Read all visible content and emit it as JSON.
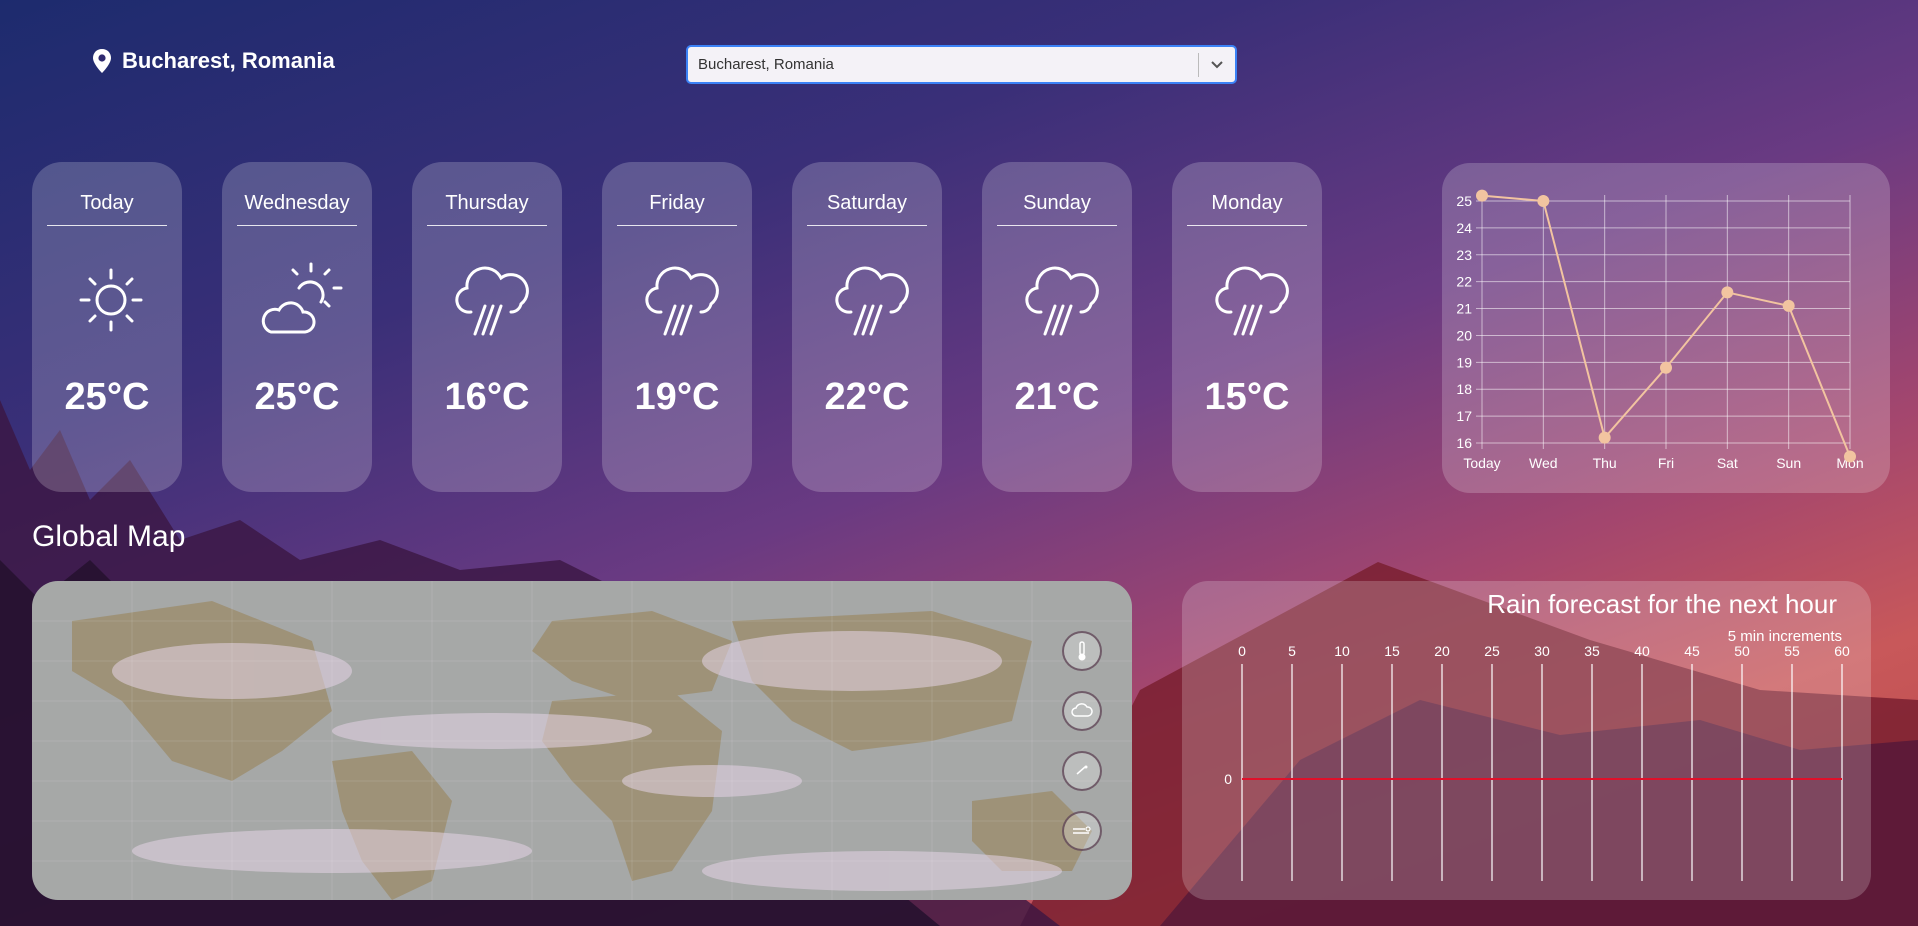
{
  "header": {
    "location_label": "Bucharest, Romania",
    "search": {
      "value": "Bucharest, Romania",
      "placeholder": "Bucharest, Romania"
    }
  },
  "forecast": [
    {
      "day": "Today",
      "icon": "sun-icon",
      "temp": "25°C"
    },
    {
      "day": "Wednesday",
      "icon": "sun-cloud-icon",
      "temp": "25°C"
    },
    {
      "day": "Thursday",
      "icon": "rain-cloud-icon",
      "temp": "16°C"
    },
    {
      "day": "Friday",
      "icon": "rain-cloud-icon",
      "temp": "19°C"
    },
    {
      "day": "Saturday",
      "icon": "rain-cloud-icon",
      "temp": "22°C"
    },
    {
      "day": "Sunday",
      "icon": "rain-cloud-icon",
      "temp": "21°C"
    },
    {
      "day": "Monday",
      "icon": "rain-cloud-icon",
      "temp": "15°C"
    }
  ],
  "map": {
    "title": "Global Map",
    "controls": [
      "thermometer-icon",
      "cloud-icon",
      "wind-icon",
      "pressure-icon"
    ]
  },
  "rain": {
    "title": "Rain forecast for the next hour",
    "subtitle": "5 min increments"
  },
  "colors": {
    "accent": "#3b82f6",
    "line": "#f2c4a0",
    "rain_line": "#e0102a"
  },
  "chart_data": [
    {
      "type": "line",
      "categories": [
        "Today",
        "Wed",
        "Thu",
        "Fri",
        "Sat",
        "Sun",
        "Mon"
      ],
      "values": [
        25.2,
        25.0,
        16.2,
        18.8,
        21.6,
        21.1,
        15.5
      ],
      "ylim": [
        16,
        25
      ],
      "yticks": [
        16,
        17,
        18,
        19,
        20,
        21,
        22,
        23,
        24,
        25
      ],
      "grid": true
    },
    {
      "type": "line",
      "x": [
        0,
        5,
        10,
        15,
        20,
        25,
        30,
        35,
        40,
        45,
        50,
        55,
        60
      ],
      "values": [
        0,
        0,
        0,
        0,
        0,
        0,
        0,
        0,
        0,
        0,
        0,
        0,
        0
      ],
      "yticks": [
        0
      ],
      "grid": true
    }
  ]
}
